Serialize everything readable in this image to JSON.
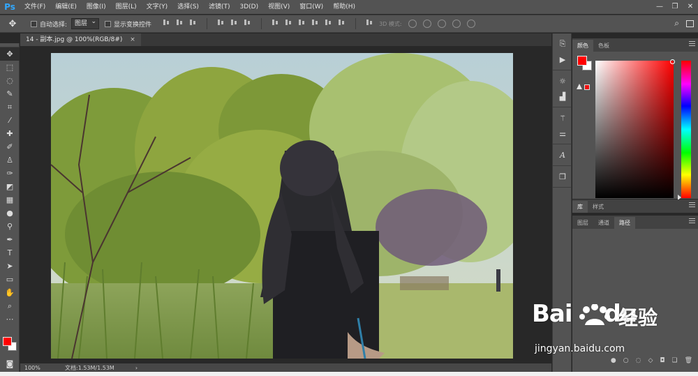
{
  "app": {
    "logo": "Ps"
  },
  "menu": [
    "文件(F)",
    "编辑(E)",
    "图像(I)",
    "图层(L)",
    "文字(Y)",
    "选择(S)",
    "滤镜(T)",
    "3D(D)",
    "视图(V)",
    "窗口(W)",
    "帮助(H)"
  ],
  "window_controls": {
    "minimize": "—",
    "restore": "❐",
    "close": "✕"
  },
  "options": {
    "auto_select_label": "自动选择:",
    "auto_select_value": "图层",
    "show_transform_label": "显示变换控件",
    "mode_3d_label": "3D 模式:"
  },
  "document": {
    "tab_title": "14 - 副本.jpg @ 100%(RGB/8#)",
    "tab_close": "×",
    "zoom": "100%",
    "doc_info": "文档:1.53M/1.53M",
    "status_arrow": "›"
  },
  "panels": {
    "color_tabs": [
      "颜色",
      "色板"
    ],
    "library_tabs": [
      "库",
      "样式"
    ],
    "layer_tabs": [
      "图层",
      "通道",
      "路径"
    ]
  },
  "colors": {
    "foreground": "#ff0000",
    "background": "#ffffff",
    "ui_bg": "#535353"
  },
  "watermark": {
    "brand": "Bai",
    "brand2": "du",
    "site_cn": "经验",
    "url": "jingyan.baidu.com"
  }
}
